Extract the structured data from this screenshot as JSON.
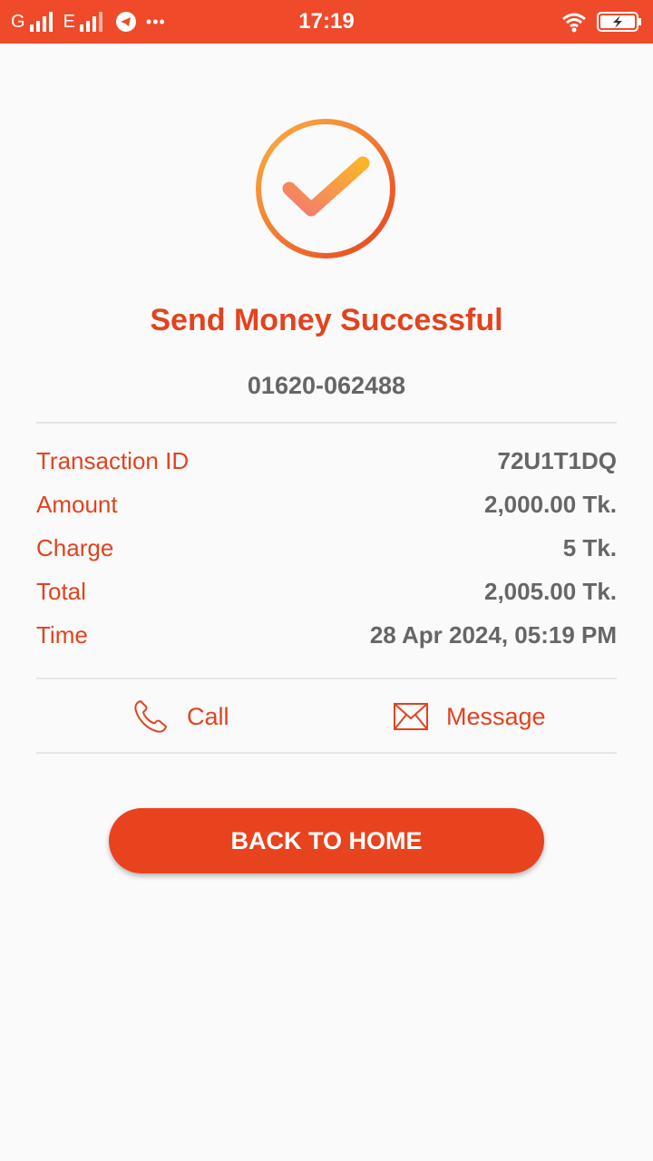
{
  "status_bar": {
    "network_1": "G",
    "network_2": "E",
    "more": "•••",
    "time": "17:19",
    "icons": [
      "signal-icon",
      "telegram-icon",
      "wifi-icon",
      "battery-charging-icon"
    ]
  },
  "colors": {
    "accent": "#e2431f",
    "status_bar": "#ef4a2a",
    "value_text": "#666666"
  },
  "success": {
    "icon": "checkmark-circle-icon",
    "title": "Send Money Successful",
    "recipient": "01620-062488"
  },
  "details": [
    {
      "label": "Transaction ID",
      "value": "72U1T1DQ"
    },
    {
      "label": "Amount",
      "value": "2,000.00 Tk."
    },
    {
      "label": "Charge",
      "value": "5 Tk."
    },
    {
      "label": "Total",
      "value": "2,005.00 Tk."
    },
    {
      "label": "Time",
      "value": "28 Apr 2024, 05:19 PM"
    }
  ],
  "actions": {
    "call_label": "Call",
    "call_icon": "phone-icon",
    "message_label": "Message",
    "message_icon": "envelope-icon"
  },
  "home_button": {
    "label": "BACK TO HOME"
  }
}
